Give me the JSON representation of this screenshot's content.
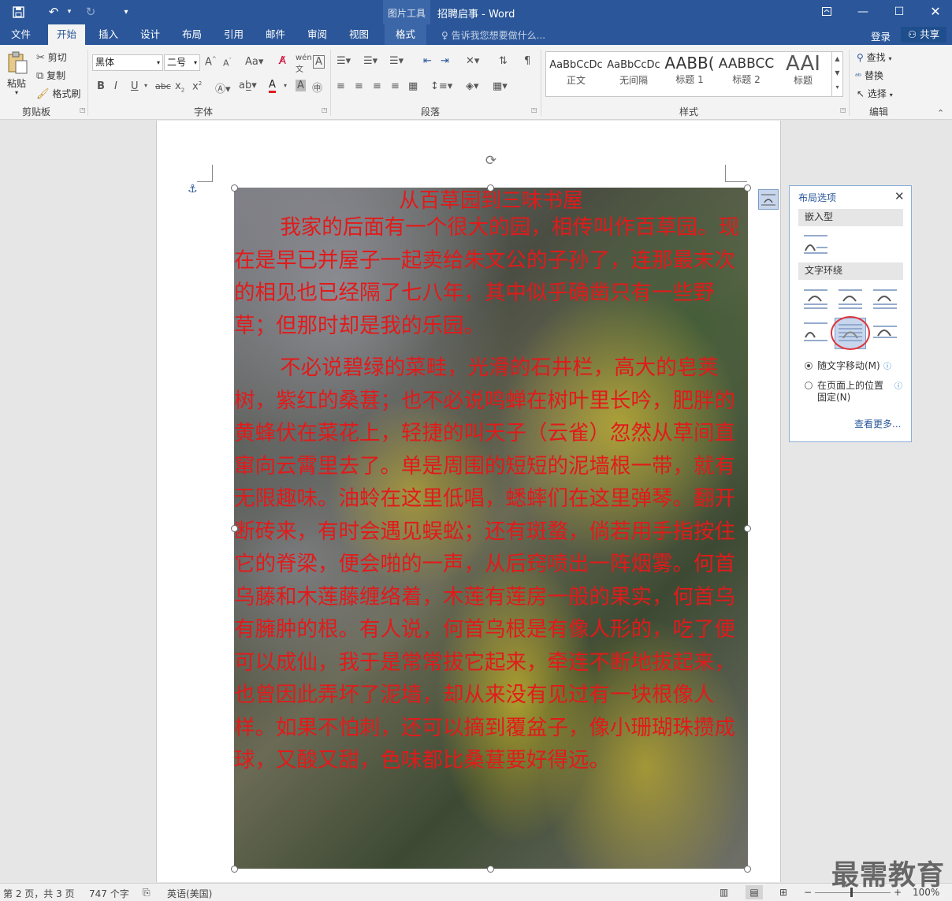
{
  "qat": {
    "save": "save-icon",
    "undo": "undo-icon",
    "redo": "redo-icon",
    "customize": "customize-icon"
  },
  "titlebar": {
    "context_group": "图片工具",
    "title": "招聘启事 - Word"
  },
  "tabs": [
    "文件",
    "开始",
    "插入",
    "设计",
    "布局",
    "引用",
    "邮件",
    "审阅",
    "视图",
    "格式"
  ],
  "tell_me": "告诉我您想要做什么...",
  "login": "登录",
  "share": "共享",
  "clipboard": {
    "paste": "粘贴",
    "cut": "剪切",
    "copy": "复制",
    "format_painter": "格式刷",
    "group": "剪贴板"
  },
  "font": {
    "name": "黑体",
    "size": "二号",
    "group": "字体"
  },
  "paragraph": {
    "group": "段落"
  },
  "styles": {
    "items": [
      {
        "preview": "AaBbCcDc",
        "name": "正文"
      },
      {
        "preview": "AaBbCcDc",
        "name": "无间隔"
      },
      {
        "preview": "AABB(",
        "name": "标题 1"
      },
      {
        "preview": "AABBCC",
        "name": "标题 2"
      },
      {
        "preview": "AAI",
        "name": "标题"
      }
    ],
    "group": "样式"
  },
  "editing": {
    "find": "查找",
    "replace": "替换",
    "select": "选择",
    "group": "编辑"
  },
  "document": {
    "title": "从百草园到三味书屋",
    "para1": "我家的后面有一个很大的园，相传叫作百草园。现在是早已并屋子一起卖给朱文公的子孙了，连那最末次的相见也已经隔了七八年，其中似乎确凿只有一些野草；但那时却是我的乐园。",
    "para2": "不必说碧绿的菜畦，光滑的石井栏，高大的皂荚树，紫红的桑葚；也不必说鸣蝉在树叶里长吟，肥胖的黄蜂伏在菜花上，轻捷的叫天子（云雀）忽然从草间直窜向云霄里去了。单是周围的短短的泥墙根一带，就有无限趣味。油蛉在这里低唱，蟋蟀们在这里弹琴。翻开断砖来，有时会遇见蜈蚣；还有斑蝥，倘若用手指按住它的脊梁，便会啪的一声，从后窍喷出一阵烟雾。何首乌藤和木莲藤缠络着，木莲有莲房一般的果实，何首乌有臃肿的根。有人说，何首乌根是有像人形的，吃了便可以成仙，我于是常常拔它起来，牵连不断地拔起来，也曾因此弄坏了泥墙，却从来没有见过有一块根像人样。如果不怕刺，还可以摘到覆盆子，像小珊瑚珠攒成球，又酸又甜，色味都比桑葚要好得远。"
  },
  "layout_panel": {
    "title": "布局选项",
    "inline_section": "嵌入型",
    "wrap_section": "文字环绕",
    "move_with_text": "随文字移动(M)",
    "fix_position_line1": "在页面上的位置",
    "fix_position_line2": "固定(N)",
    "see_more": "查看更多..."
  },
  "status": {
    "page": "第 2 页，共 3 页",
    "words": "747 个字",
    "language": "英语(美国)",
    "zoom": "100%"
  },
  "watermark": "最需教育",
  "colors": {
    "accent": "#2b579a",
    "doc_text": "#e21a1a",
    "highlight_circle": "#e0363c"
  }
}
